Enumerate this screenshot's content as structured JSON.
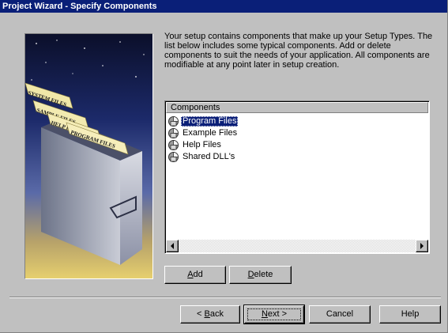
{
  "window": {
    "title": "Project Wizard - Specify Components"
  },
  "intro_text": "Your setup contains components that make up your Setup Types. The list below includes some typical components.  Add or delete components to suit the needs of your application.  All components are modifiable at any point later in setup creation.",
  "graphic": {
    "tab_labels": [
      "SYSTEM FILES",
      "SAMPLE FILES",
      "HELP FILES",
      "PROGRAM FILES"
    ]
  },
  "components": {
    "header": "Components",
    "items": [
      {
        "label": "Program Files",
        "icon": "component-icon",
        "selected": true
      },
      {
        "label": "Example Files",
        "icon": "component-icon",
        "selected": false
      },
      {
        "label": "Help Files",
        "icon": "component-icon",
        "selected": false
      },
      {
        "label": "Shared DLL's",
        "icon": "component-icon",
        "selected": false
      }
    ]
  },
  "actions": {
    "add": {
      "accel": "A",
      "rest": "dd"
    },
    "delete": {
      "accel": "D",
      "rest": "elete"
    }
  },
  "footer": {
    "back": {
      "pre": "< ",
      "accel": "B",
      "rest": "ack"
    },
    "next": {
      "accel": "N",
      "rest": "ext >"
    },
    "cancel": "Cancel",
    "help": "Help"
  },
  "colors": {
    "titlebar": "#0a1f78",
    "face": "#c0c0c0",
    "selection": "#0a1f78"
  }
}
